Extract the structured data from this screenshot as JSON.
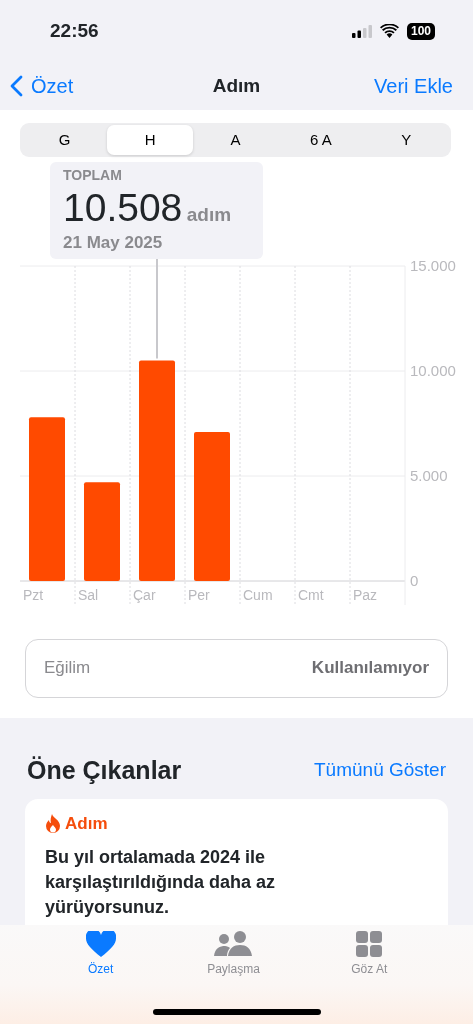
{
  "status_bar": {
    "time": "22:56",
    "battery": "100"
  },
  "nav": {
    "back": "Özet",
    "title": "Adım",
    "action": "Veri Ekle"
  },
  "segments": [
    {
      "label": "G",
      "selected": false
    },
    {
      "label": "H",
      "selected": true
    },
    {
      "label": "A",
      "selected": false
    },
    {
      "label": "6 A",
      "selected": false
    },
    {
      "label": "Y",
      "selected": false
    }
  ],
  "summary": {
    "label": "TOPLAM",
    "value": "10.508",
    "unit": "adım",
    "date": "21 May 2025"
  },
  "chart_data": {
    "type": "bar",
    "categories": [
      "Pzt",
      "Sal",
      "Çar",
      "Per",
      "Cum",
      "Cmt",
      "Paz"
    ],
    "series": [
      {
        "color": "#ff4a00",
        "values": [
          7800,
          4700,
          10500,
          7100,
          null,
          null,
          null
        ]
      }
    ],
    "ylim": [
      0,
      15000
    ],
    "yticks": [
      {
        "value": 0,
        "label": "0"
      },
      {
        "value": 5000,
        "label": "5.000"
      },
      {
        "value": 10000,
        "label": "10.000"
      },
      {
        "value": 15000,
        "label": "15.000"
      }
    ],
    "annotations": [
      {
        "x": "Çar"
      }
    ]
  },
  "trend": {
    "label": "Eğilim",
    "value": "Kullanılamıyor"
  },
  "highlights": {
    "title": "Öne Çıkanlar",
    "link": "Tümünü Göster",
    "card": {
      "category": "Adım",
      "text": "Bu yıl ortalamada 2024 ile karşılaştırıldığında daha az yürüyorsunuz."
    }
  },
  "tab_bar": [
    {
      "label": "Özet",
      "kind": "heart",
      "selected": true
    },
    {
      "label": "Paylaşma",
      "kind": "people",
      "selected": false
    },
    {
      "label": "Göz At",
      "kind": "grid",
      "selected": false
    }
  ]
}
